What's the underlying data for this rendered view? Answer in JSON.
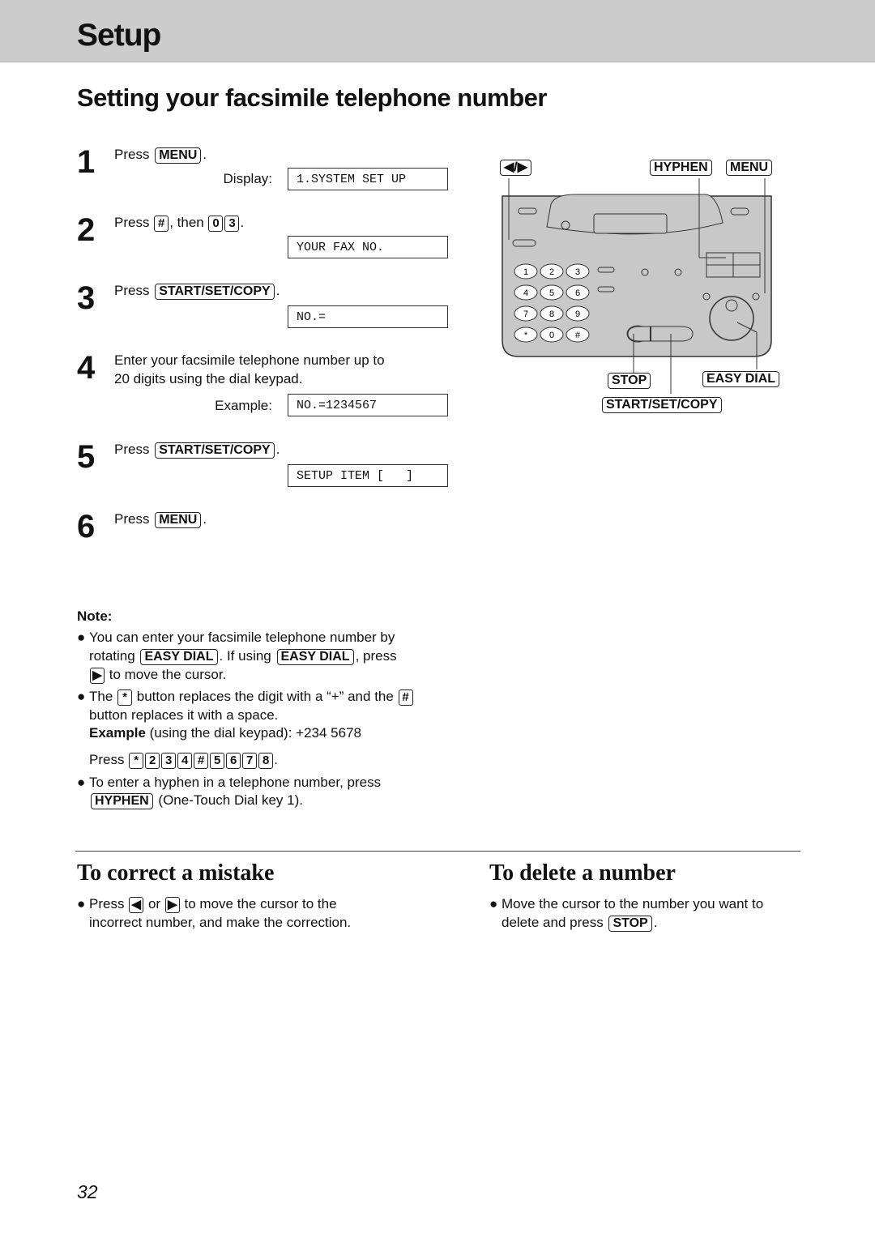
{
  "header": {
    "section": "Setup"
  },
  "title": "Setting your facsimile telephone number",
  "steps": [
    {
      "num": "1",
      "press": "Press",
      "key": "MENU",
      "end": ".",
      "display_label": "Display:",
      "display": "1.SYSTEM SET UP"
    },
    {
      "num": "2",
      "press": "Press",
      "key": "#",
      "then": ", then",
      "key2": "0",
      "key3": "3",
      "end": ".",
      "display": "YOUR FAX NO."
    },
    {
      "num": "3",
      "press": "Press",
      "key": "START/SET/COPY",
      "end": ".",
      "display": "NO.="
    },
    {
      "num": "4",
      "line1": "Enter your facsimile telephone number up to",
      "line2": "20 digits using the dial keypad.",
      "display_label": "Example:",
      "display": "NO.=1234567"
    },
    {
      "num": "5",
      "press": "Press",
      "key": "START/SET/COPY",
      "end": ".",
      "display": "SETUP ITEM [   ]"
    },
    {
      "num": "6",
      "press": "Press",
      "key": "MENU",
      "end": "."
    }
  ],
  "note": {
    "heading": "Note:",
    "b1": {
      "l1": "You can enter your facsimile telephone number by",
      "rotating": "rotating",
      "key": "EASY DIAL",
      "mid": ". If using",
      "end": ", press",
      "l3": "to move the cursor."
    },
    "b2": {
      "the": "The",
      "key_star": "*",
      "mid": "button replaces the digit with a “+” and the",
      "key_hash": "#",
      "l2": "button replaces it with a space.",
      "ex_bold": "Example",
      "ex_rest": "(using the dial keypad):  +234  5678",
      "press": "Press",
      "keys": [
        "*",
        "2",
        "3",
        "4",
        "#",
        "5",
        "6",
        "7",
        "8"
      ],
      "end": "."
    },
    "b3": {
      "l1": "To enter a hyphen in a telephone number, press",
      "key": "HYPHEN",
      "l2": "(One-Touch Dial key 1)."
    }
  },
  "correct": {
    "title": "To correct a mistake",
    "press": "Press",
    "or": "or",
    "rest": "to move the cursor to the",
    "l2": "incorrect number, and make the correction."
  },
  "delete": {
    "title": "To delete a number",
    "l1": "Move the cursor to the number you want to",
    "l2": "delete and press",
    "key": "STOP",
    "end": "."
  },
  "diagram": {
    "labels": {
      "arrows": "◀/▶",
      "hyphen": "HYPHEN",
      "menu": "MENU",
      "stop": "STOP",
      "easy_dial": "EASY DIAL",
      "start": "START/SET/COPY"
    },
    "keypad": [
      "1",
      "2",
      "3",
      "4",
      "5",
      "6",
      "7",
      "8",
      "9",
      "*",
      "0",
      "#"
    ]
  },
  "page_number": "32"
}
